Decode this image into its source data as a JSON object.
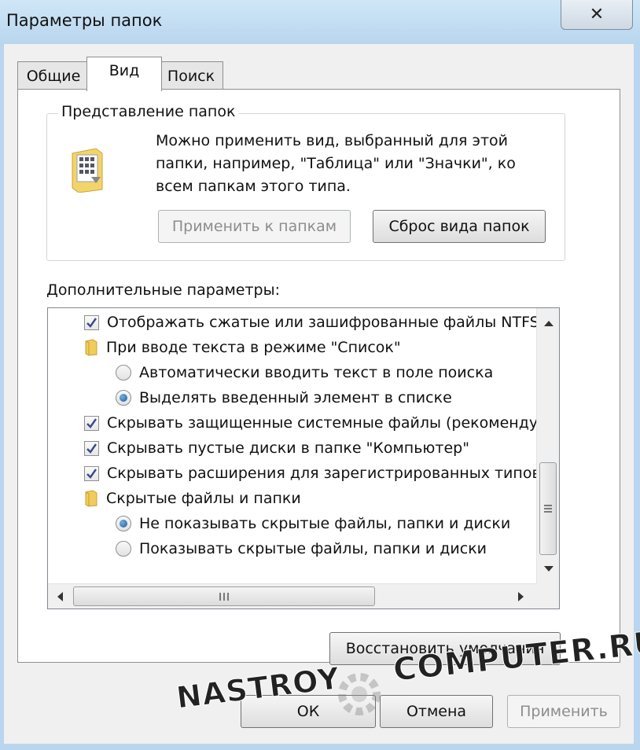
{
  "window": {
    "title": "Параметры папок",
    "close_glyph": "✕"
  },
  "tabs": [
    {
      "label": "Общие",
      "selected": false
    },
    {
      "label": "Вид",
      "selected": true
    },
    {
      "label": "Поиск",
      "selected": false
    }
  ],
  "folder_views": {
    "title": "Представление папок",
    "description": "Можно применить вид, выбранный для этой папки, например, \"Таблица\" или \"Значки\", ко всем папкам этого типа.",
    "apply_button": "Применить к папкам",
    "reset_button": "Сброс вида папок",
    "icon": "folder-view-icon"
  },
  "advanced": {
    "label": "Дополнительные параметры:",
    "items": [
      {
        "type": "checkbox",
        "checked": true,
        "text": "Отображать сжатые или зашифрованные файлы NTFS другим цветом"
      },
      {
        "type": "folder",
        "text": "При вводе текста в режиме \"Список\""
      },
      {
        "type": "radio",
        "selected": false,
        "text": "Автоматически вводить текст в поле поиска"
      },
      {
        "type": "radio",
        "selected": true,
        "text": "Выделять введенный элемент в списке"
      },
      {
        "type": "checkbox",
        "checked": true,
        "text": "Скрывать защищенные системные файлы (рекомендуется)"
      },
      {
        "type": "checkbox",
        "checked": true,
        "text": "Скрывать пустые диски в папке \"Компьютер\""
      },
      {
        "type": "checkbox",
        "checked": true,
        "text": "Скрывать расширения для зарегистрированных типов файлов"
      },
      {
        "type": "folder",
        "text": "Скрытые файлы и папки"
      },
      {
        "type": "radio",
        "selected": true,
        "text": "Не показывать скрытые файлы, папки и диски"
      },
      {
        "type": "radio",
        "selected": false,
        "text": "Показывать скрытые файлы, папки и диски"
      }
    ]
  },
  "restore_button": "Восстановить умолчания",
  "footer": {
    "ok": "ОК",
    "cancel": "Отмена",
    "apply": "Применить"
  },
  "watermark": {
    "left": "NASTROY",
    "right": "COMPUTER.RU"
  },
  "colors": {
    "title_bar": "#b9d6ee",
    "radio_dot": "#1b5b98",
    "check_mark": "#3a4a8a"
  }
}
